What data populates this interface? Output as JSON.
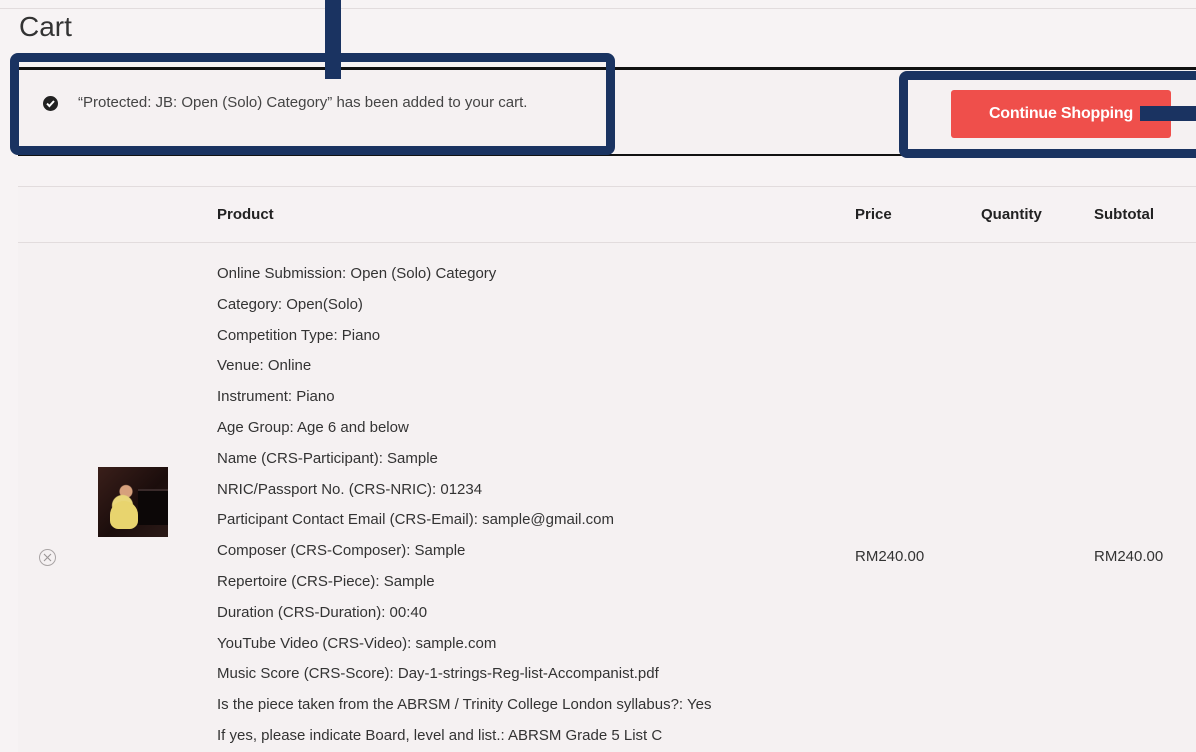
{
  "page": {
    "title": "Cart"
  },
  "notice": {
    "message": "“Protected: JB: Open (Solo) Category” has been added to your cart.",
    "button_label": "Continue Shopping",
    "icon": "check-circle-icon"
  },
  "table": {
    "headers": {
      "product": "Product",
      "price": "Price",
      "quantity": "Quantity",
      "subtotal": "Subtotal"
    },
    "rows": [
      {
        "product_lines": [
          "Online Submission: Open (Solo) Category",
          "Category: Open(Solo)",
          "Competition Type: Piano",
          "Venue: Online",
          "Instrument: Piano",
          "Age Group: Age 6 and below",
          "Name (CRS-Participant): Sample",
          "NRIC/Passport No. (CRS-NRIC): 01234",
          "Participant Contact Email (CRS-Email): sample@gmail.com",
          "Composer (CRS-Composer): Sample",
          "Repertoire (CRS-Piece): Sample",
          "Duration (CRS-Duration): 00:40",
          "YouTube Video (CRS-Video): sample.com",
          "Music Score (CRS-Score): Day-1-strings-Reg-list-Accompanist.pdf",
          "Is the piece taken from the ABRSM / Trinity College London syllabus?: Yes",
          "If yes, please indicate Board, level and list.: ABRSM Grade 5 List C"
        ],
        "price": "RM240.00",
        "subtotal": "RM240.00",
        "remove_icon": "remove-circle-icon",
        "thumbnail": "piano-performer-thumbnail"
      }
    ]
  },
  "colors": {
    "accent_button": "#ef4f4b",
    "annotation": "#1a3361",
    "background": "#f7f3f4"
  }
}
